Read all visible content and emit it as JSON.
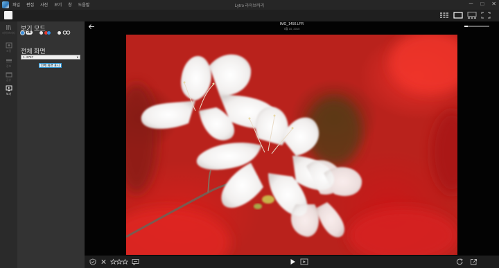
{
  "titlebar": {
    "menu": [
      "파일",
      "편집",
      "사진",
      "보기",
      "창",
      "도움말"
    ],
    "title": "Lytro 라이브러리",
    "controls": [
      "─",
      "□",
      "✕"
    ]
  },
  "toolbar": {
    "view_modes": [
      "grid-view-icon",
      "single-view-icon",
      "filmstrip-view-icon",
      "fullscreen-icon"
    ],
    "active_view": "single-view-icon"
  },
  "rail": {
    "items": [
      {
        "icon": "library-icon",
        "label": "라이브러리"
      },
      {
        "icon": "adjust-icon",
        "label": "조정"
      },
      {
        "icon": "info-icon",
        "label": "정보"
      },
      {
        "icon": "share-icon",
        "label": "공유"
      },
      {
        "icon": "view-icon",
        "label": "보기"
      }
    ],
    "active": 4
  },
  "panel": {
    "view_mode_heading": "보기 모드",
    "view_options": [
      "2D",
      "anaglyph",
      "3D"
    ],
    "selected_view_option": "2D",
    "fullscreen_heading": "전체 화면",
    "display_select_value": "1. 2757",
    "fullscreen_button": "전체 화면 표시"
  },
  "viewer": {
    "file_name": "IMG_1450.LFR",
    "file_date": "5월 10, 2015",
    "zoom_level": 0.15
  },
  "colors": {
    "accent": "#3a8edb",
    "panel_bg": "#333333",
    "rail_bg": "#2a2a2a",
    "viewer_bg": "#030303"
  }
}
